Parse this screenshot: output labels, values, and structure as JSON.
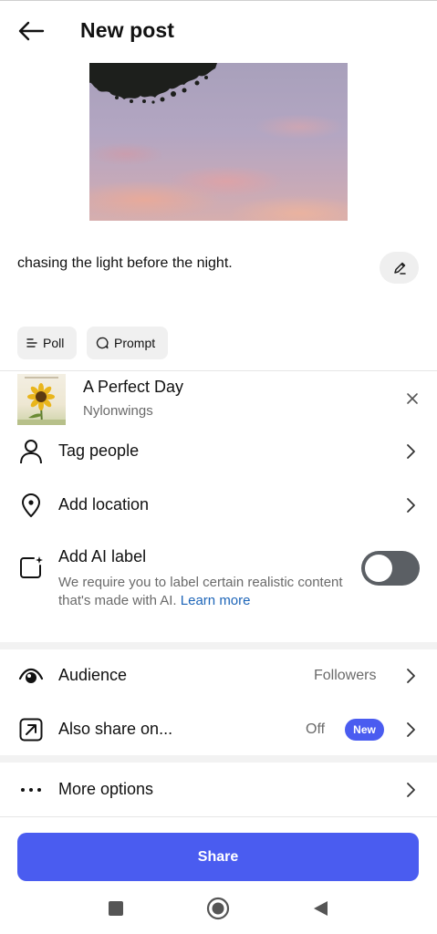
{
  "header": {
    "title": "New post",
    "back_icon": "arrow-left-icon"
  },
  "post": {
    "caption": "chasing the light before the night.",
    "edit_icon": "pencil-icon"
  },
  "chips": [
    {
      "label": "Poll",
      "icon": "poll-lines-icon"
    },
    {
      "label": "Prompt",
      "icon": "speech-bubble-icon"
    }
  ],
  "music": {
    "title": "A Perfect Day",
    "artist": "Nylonwings",
    "close_icon": "close-icon"
  },
  "options": {
    "tag_people": "Tag people",
    "add_location": "Add location",
    "ai_label": {
      "title": "Add AI label",
      "description": "We require you to label certain realistic content that's made with AI.",
      "link": "Learn more",
      "enabled": false
    },
    "audience": {
      "label": "Audience",
      "value": "Followers"
    },
    "also_share": {
      "label": "Also share on...",
      "value": "Off",
      "badge": "New"
    },
    "more_options": "More options"
  },
  "share_button": "Share",
  "colors": {
    "accent": "#4a5cf0",
    "link": "#1d65b8",
    "toggle_off": "#5b5f64",
    "secondary_text": "#6a6a6a"
  },
  "system_nav": [
    "square-icon",
    "home-circle-icon",
    "back-triangle-icon"
  ]
}
